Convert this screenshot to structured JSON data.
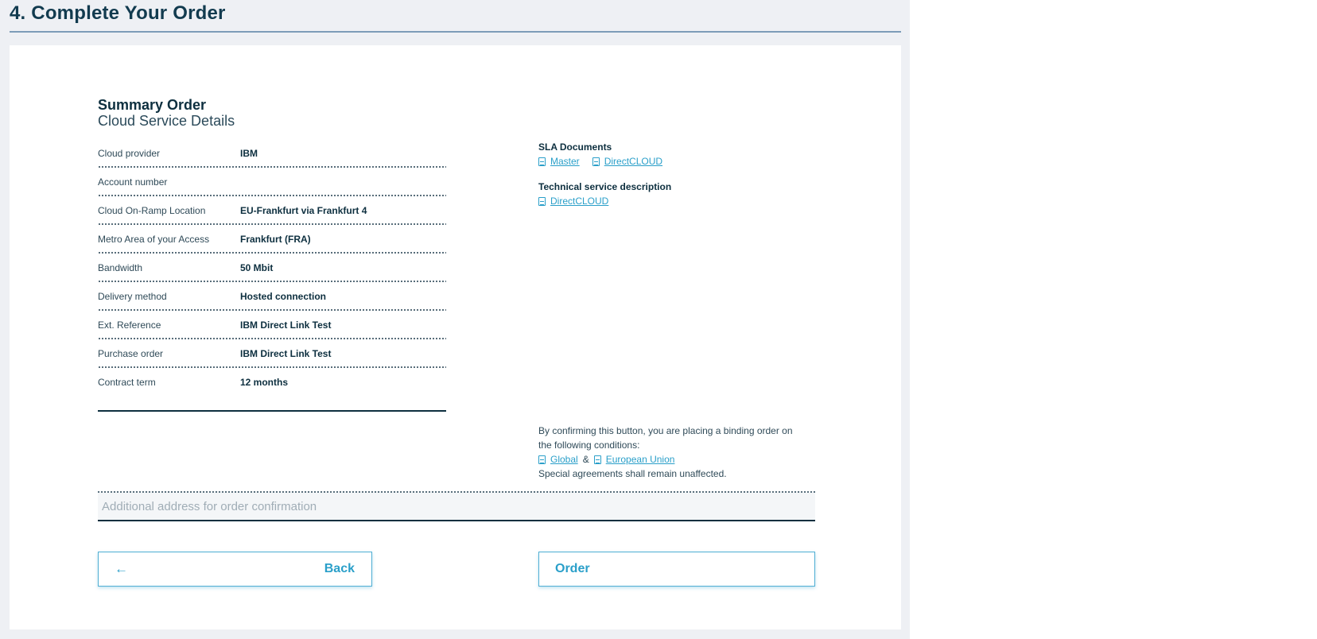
{
  "page": {
    "title": "4. Complete Your Order"
  },
  "summary": {
    "heading": "Summary Order",
    "subheading": "Cloud Service Details",
    "rows": [
      {
        "label": "Cloud provider",
        "value": "IBM"
      },
      {
        "label": "Account number",
        "value": ""
      },
      {
        "label": "Cloud On-Ramp Location",
        "value": "EU-Frankfurt via Frankfurt 4"
      },
      {
        "label": "Metro Area of your Access",
        "value": "Frankfurt (FRA)"
      },
      {
        "label": "Bandwidth",
        "value": "50 Mbit"
      },
      {
        "label": "Delivery method",
        "value": "Hosted connection"
      },
      {
        "label": "Ext. Reference",
        "value": "IBM Direct Link Test"
      },
      {
        "label": "Purchase order",
        "value": "IBM Direct Link Test"
      },
      {
        "label": "Contract term",
        "value": "12 months"
      }
    ]
  },
  "documents": {
    "sla_heading": "SLA Documents",
    "sla_links": [
      "Master",
      "DirectCLOUD"
    ],
    "tech_heading": "Technical service description",
    "tech_links": [
      "DirectCLOUD"
    ]
  },
  "confirm": {
    "text_line1": "By confirming this button, you are placing a binding order on",
    "text_line2": "the following conditions:",
    "link_global": "Global",
    "ampersand": "&",
    "link_eu": "European Union",
    "text_line3": "Special agreements shall remain unaffected."
  },
  "email": {
    "placeholder": "Additional address for order confirmation",
    "value": ""
  },
  "buttons": {
    "back": "Back",
    "back_arrow": "←",
    "order": "Order"
  },
  "colors": {
    "accent": "#2a9fc9",
    "text": "#0d2f3f",
    "panel": "#eef0f4"
  },
  "icons": {
    "document": "document-icon",
    "back": "arrow-left-icon"
  }
}
